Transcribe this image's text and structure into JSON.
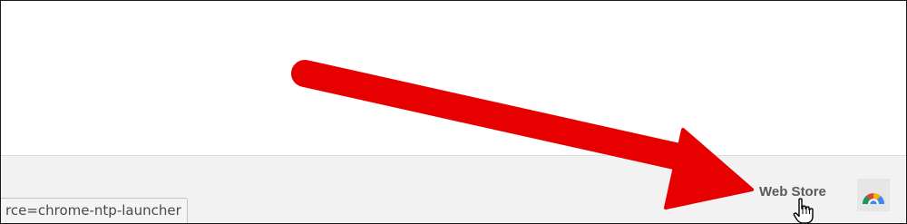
{
  "status_bar": {
    "url_text": "rce=chrome-ntp-launcher"
  },
  "app_launcher": {
    "web_store_label": "Web Store",
    "store_icon": "chrome-web-store-icon"
  },
  "annotation": {
    "arrow_color": "#e60000",
    "arrow_icon": "red-arrow-icon",
    "cursor_icon": "hand-pointer-icon"
  }
}
